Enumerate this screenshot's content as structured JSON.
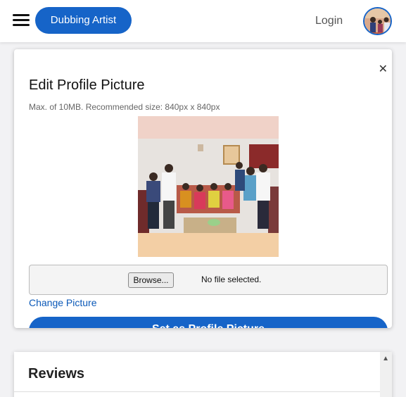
{
  "header": {
    "title": "Dubbing Artist",
    "login": "Login"
  },
  "modal": {
    "title": "Edit Profile Picture",
    "hint": "Max. of 10MB. Recommended size: 840px x 840px",
    "browse": "Browse...",
    "no_file": "No file selected.",
    "change_link": "Change Picture",
    "set_button": "Set as Profile Picture"
  },
  "reviews": {
    "title": "Reviews"
  }
}
